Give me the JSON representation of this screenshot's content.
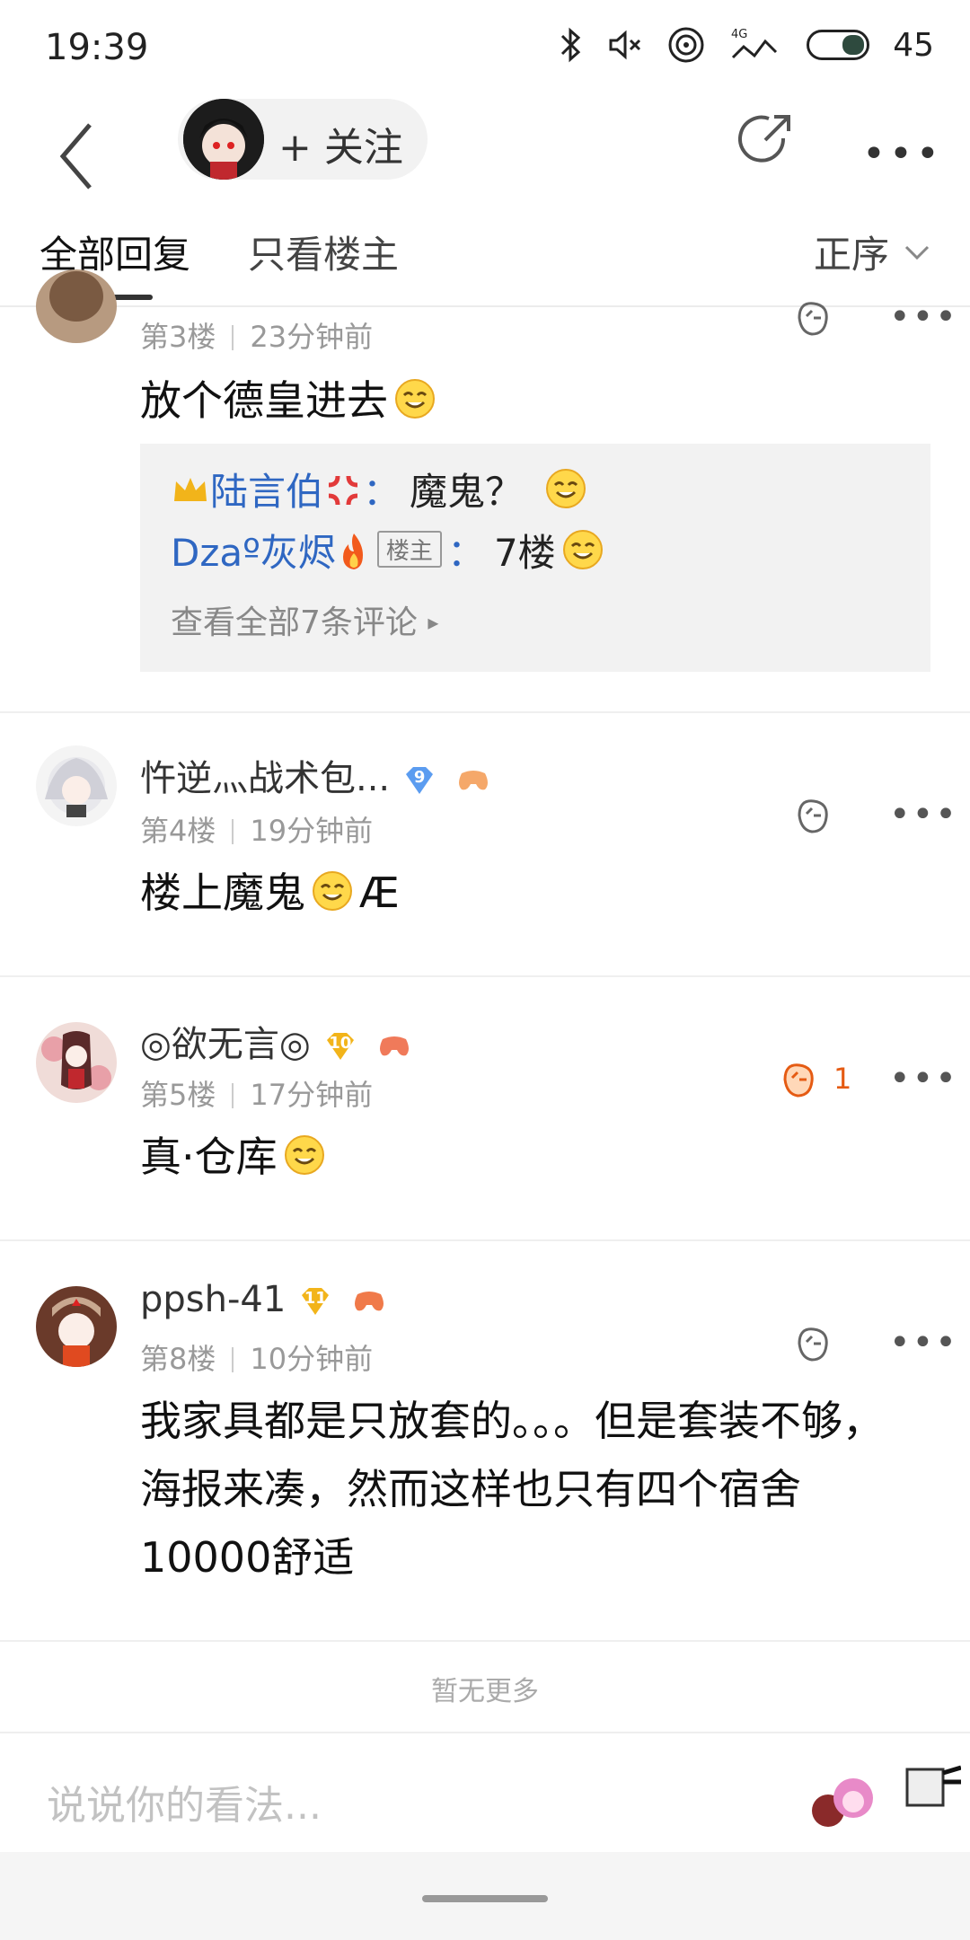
{
  "status_bar": {
    "time": "19:39",
    "battery": "45",
    "network": "4G"
  },
  "header": {
    "follow_label": "+ 关注"
  },
  "tabs": {
    "all_replies": "全部回复",
    "op_only": "只看楼主",
    "sort": "正序"
  },
  "posts": [
    {
      "floor": "第3楼",
      "time": "23分钟前",
      "content": "放个德皇进去",
      "comments": [
        {
          "name": "陆言伯",
          "sep": "：",
          "text": "魔鬼？"
        },
        {
          "name": "Dzaº灰烬",
          "badge": "楼主",
          "sep": "：",
          "text": "7楼"
        }
      ],
      "view_all": "查看全部7条评论"
    },
    {
      "username": "忤逆灬战术包...",
      "level": "9",
      "floor": "第4楼",
      "time": "19分钟前",
      "content": "楼上魔鬼",
      "suffix": "Æ"
    },
    {
      "username": "◎欲无言◎",
      "level": "10",
      "floor": "第5楼",
      "time": "17分钟前",
      "content": "真·仓库",
      "likes": "1"
    },
    {
      "username": "ppsh-41",
      "level": "11",
      "floor": "第8楼",
      "time": "10分钟前",
      "content": "我家具都是只放套的。。。但是套装不够，海报来凑，然而这样也只有四个宿舍10000舒适"
    }
  ],
  "footer": {
    "no_more": "暂无更多",
    "comment_placeholder": "说说你的看法..."
  },
  "colors": {
    "link_blue": "#2f67c2",
    "like_orange": "#e55b13",
    "badge_blue": "#5b9cf0",
    "badge_gold": "#f2b41a"
  }
}
